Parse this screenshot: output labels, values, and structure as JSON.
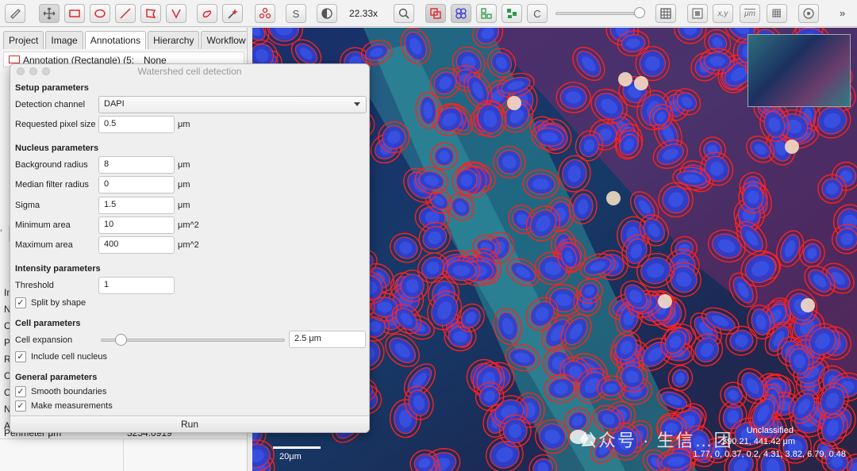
{
  "toolbar": {
    "zoom": "22.33x",
    "buttons": [
      {
        "name": "measure-icon"
      },
      {
        "name": "move-icon"
      },
      {
        "name": "rectangle-icon"
      },
      {
        "name": "ellipse-icon"
      },
      {
        "name": "line-icon"
      },
      {
        "name": "polygon-icon"
      },
      {
        "name": "polyline-icon"
      },
      {
        "name": "brush-icon"
      },
      {
        "name": "wand-icon"
      },
      {
        "name": "points-icon"
      },
      {
        "name": "selection-mode-icon"
      },
      {
        "name": "contrast-icon"
      },
      {
        "name": "zoom-to-fit-icon"
      },
      {
        "name": "show-annotations-icon"
      },
      {
        "name": "show-tma-grid-icon"
      },
      {
        "name": "show-detections-icon"
      },
      {
        "name": "fill-detections-icon"
      },
      {
        "name": "cell-boundaries-icon"
      },
      {
        "name": "grid-icon"
      },
      {
        "name": "overview-icon"
      },
      {
        "name": "location-icon"
      },
      {
        "name": "scalebar-icon"
      },
      {
        "name": "pixel-grid-icon"
      },
      {
        "name": "settings-icon"
      }
    ],
    "selection_label": "S",
    "c_label": "C",
    "xy_label": "x,y",
    "um_label": "μm",
    "more_label": "»",
    "opacity_level": 0.98
  },
  "left_panel": {
    "tabs": [
      "Project",
      "Image",
      "Annotations",
      "Hierarchy",
      "Workflow"
    ],
    "active_tab": "Annotations",
    "annotation_row": {
      "label": "Annotation (Rectangle) (5:",
      "value": "None"
    },
    "side_letters": [
      "Im",
      "Na",
      "Cl",
      "Pa",
      "Ro",
      "Ce",
      "Ce",
      "Nu",
      "Ar"
    ],
    "bottom_row": {
      "key": "Perimeter μm",
      "value": "3254.0919"
    }
  },
  "dialog": {
    "title": "Watershed cell detection",
    "setup_header": "Setup parameters",
    "detection_channel_label": "Detection channel",
    "detection_channel_value": "DAPI",
    "pixel_size_label": "Requested pixel size",
    "pixel_size_value": "0.5",
    "pixel_size_unit": "μm",
    "nucleus_header": "Nucleus parameters",
    "bg_radius_label": "Background radius",
    "bg_radius_value": "8",
    "bg_radius_unit": "μm",
    "median_label": "Median filter radius",
    "median_value": "0",
    "median_unit": "μm",
    "sigma_label": "Sigma",
    "sigma_value": "1.5",
    "sigma_unit": "μm",
    "min_area_label": "Minimum area",
    "min_area_value": "10",
    "min_area_unit": "μm^2",
    "max_area_label": "Maximum area",
    "max_area_value": "400",
    "max_area_unit": "μm^2",
    "intensity_header": "Intensity parameters",
    "threshold_label": "Threshold",
    "threshold_value": "1",
    "split_label": "Split by shape",
    "cell_header": "Cell parameters",
    "expansion_label": "Cell expansion",
    "expansion_value": "2.5 μm",
    "include_nucleus_label": "Include cell nucleus",
    "general_header": "General parameters",
    "smooth_label": "Smooth boundaries",
    "measurements_label": "Make measurements",
    "run_label": "Run",
    "check_mark": "✓"
  },
  "viewer": {
    "scalebar_label": "20μm",
    "status_line1": "Unclassified",
    "status_line2": "390.21, 441.42 μm",
    "status_line3": "1.77, 0, 0.37, 0.2, 4.31, 3.82, 6.79, 0.48",
    "watermark": "公众号 · 生信…团"
  }
}
